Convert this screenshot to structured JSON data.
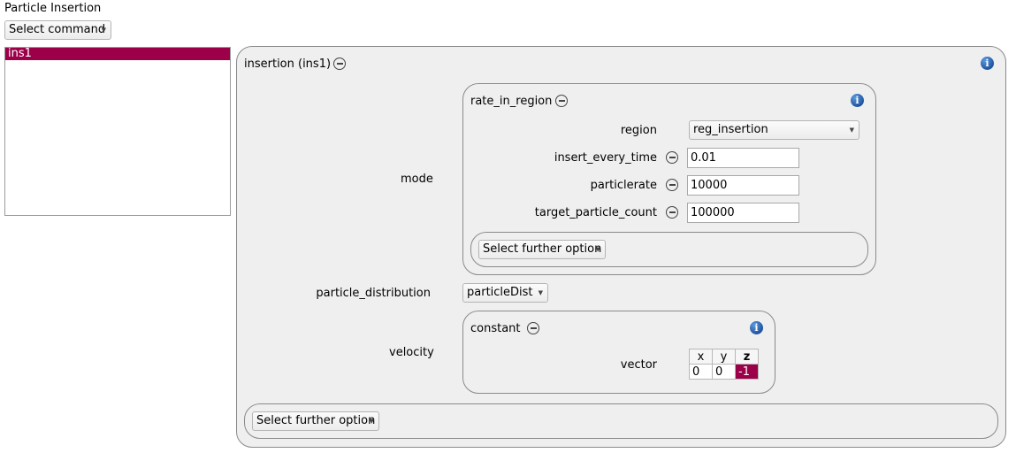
{
  "window": {
    "title": "Particle Insertion"
  },
  "command_select": {
    "label": "Select command"
  },
  "command_list": {
    "items": [
      "ins1"
    ],
    "selected": "ins1"
  },
  "insertion": {
    "title": "insertion (ins1)",
    "mode_label": "mode",
    "mode": {
      "title": "rate_in_region",
      "region_label": "region",
      "region_value": "reg_insertion",
      "insert_every_time_label": "insert_every_time",
      "insert_every_time_value": "0.01",
      "particlerate_label": "particlerate",
      "particlerate_value": "10000",
      "target_particle_count_label": "target_particle_count",
      "target_particle_count_value": "100000",
      "further_option": "Select further option"
    },
    "particle_distribution_label": "particle_distribution",
    "particle_distribution_value": "particleDist",
    "velocity_label": "velocity",
    "velocity": {
      "title": "constant",
      "vector_label": "vector",
      "vector_headers": [
        "x",
        "y",
        "z"
      ],
      "vector_values": [
        "0",
        "0",
        "-1"
      ]
    },
    "further_option": "Select further option"
  },
  "icons": {
    "info": "info-icon",
    "remove": "minus-circle-icon",
    "dropdown": "dropdown-arrow-icon"
  },
  "colors": {
    "selection": "#9b0048",
    "info_icon": "#1d5fb0",
    "panel_bg": "#efefef"
  }
}
